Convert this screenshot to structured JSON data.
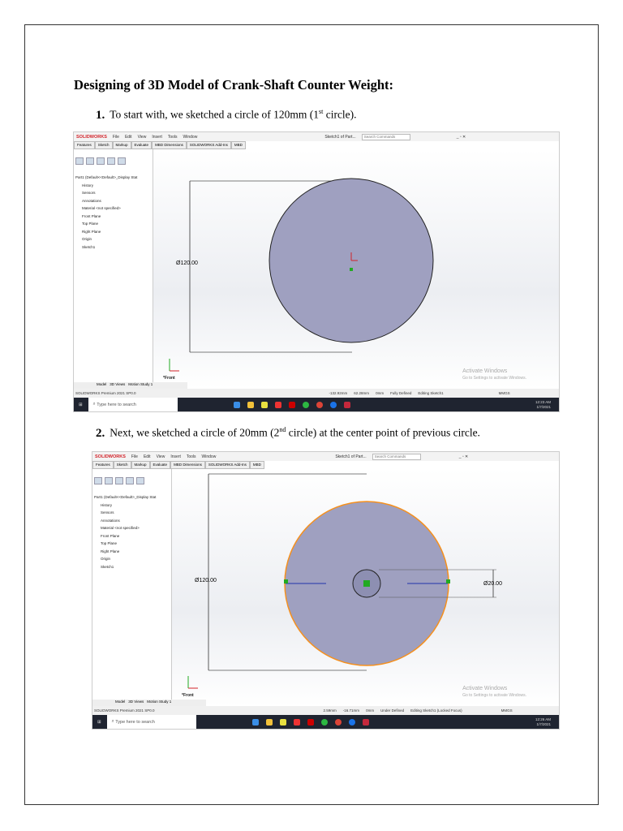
{
  "heading": "Designing of 3D Model of Crank-Shaft Counter Weight:",
  "steps": [
    {
      "num": "1.",
      "text_a": "To start with, we sketched a circle of 120mm (1",
      "sup": "st",
      "text_b": " circle)."
    },
    {
      "num": "2.",
      "text_a": "Next, we sketched a circle of 20mm (2",
      "sup": "nd",
      "text_b": " circle) at the center point of previous circle."
    }
  ],
  "app": {
    "logo": "SOLIDWORKS",
    "menus": [
      "File",
      "Edit",
      "View",
      "Insert",
      "Tools",
      "Window"
    ],
    "doc_title": "Sketch1 of Part...",
    "search_placeholder": "Search Commands",
    "tabs": [
      "Features",
      "Sketch",
      "Markup",
      "Evaluate",
      "MBD Dimensions",
      "SOLIDWORKS Add-Ins",
      "MBD"
    ],
    "tree": [
      "Part1 (Default<<Default>_Display Stat",
      "History",
      "Sensors",
      "Annotations",
      "Material <not specified>",
      "Front Plane",
      "Top Plane",
      "Right Plane",
      "Origin",
      "Sketch1"
    ],
    "bottom_tabs": [
      "Model",
      "3D Views",
      "Motion Study 1"
    ],
    "view_label": "*Front",
    "version": "SOLIDWORKS Premium 2021 SP0.0",
    "units": "MMGS",
    "activate_title": "Activate Windows",
    "activate_sub": "Go to Settings to activate Windows.",
    "taskbar_search": "Type here to search"
  },
  "shot1": {
    "dimension": "Ø120.00",
    "x": "-132.92mm",
    "y": "62.28mm",
    "z": "0mm",
    "state": "Fully Defined",
    "editing": "Editing Sketch1",
    "time": "12:23 AM",
    "date": "1/7/2021"
  },
  "shot2": {
    "dimension": "Ø120.00",
    "dimension_small": "Ø20.00",
    "x": "2.59mm",
    "y": "-16.71mm",
    "z": "0mm",
    "state": "Under Defined",
    "editing": "Editing Sketch1 (Locked Focus)",
    "time": "12:26 AM",
    "date": "1/7/2021"
  },
  "colors": {
    "circle_fill": "#9fa0c0",
    "selected": "#f5901e",
    "sw_red": "#d2232a"
  }
}
